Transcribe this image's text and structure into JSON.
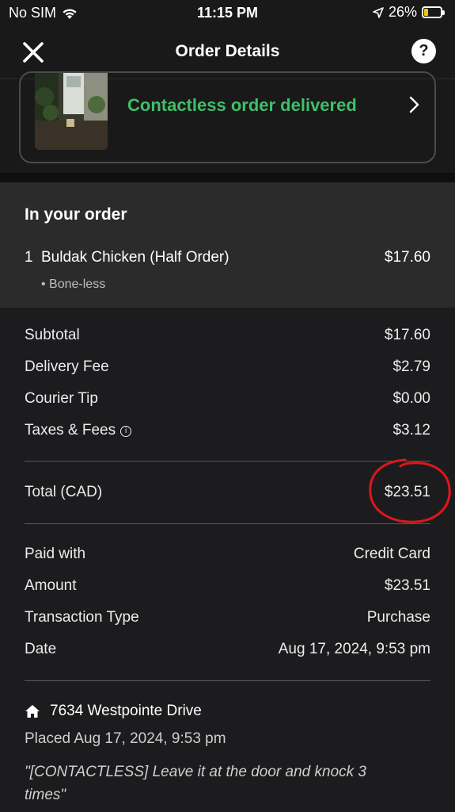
{
  "status_bar": {
    "carrier": "No SIM",
    "time": "11:15 PM",
    "battery_percent": "26%",
    "battery_level": 0.26
  },
  "header": {
    "title": "Order Details",
    "help_label": "?"
  },
  "delivery": {
    "status_text": "Contactless order delivered"
  },
  "order": {
    "heading": "In your order",
    "items": [
      {
        "qty": "1",
        "name": "Buldak Chicken (Half Order)",
        "price": "$17.60",
        "option": "• Bone-less"
      }
    ]
  },
  "summary": {
    "subtotal_label": "Subtotal",
    "subtotal_value": "$17.60",
    "delivery_fee_label": "Delivery Fee",
    "delivery_fee_value": "$2.79",
    "courier_tip_label": "Courier Tip",
    "courier_tip_value": "$0.00",
    "taxes_label": "Taxes & Fees",
    "taxes_value": "$3.12",
    "total_label": "Total (CAD)",
    "total_value": "$23.51"
  },
  "payment": {
    "paid_with_label": "Paid with",
    "paid_with_value": "Credit Card",
    "amount_label": "Amount",
    "amount_value": "$23.51",
    "transaction_type_label": "Transaction Type",
    "transaction_type_value": "Purchase",
    "date_label": "Date",
    "date_value": "Aug 17, 2024, 9:53 pm"
  },
  "footer": {
    "address": "7634 Westpointe Drive",
    "placed": "Placed Aug 17, 2024, 9:53 pm",
    "note": "\"[CONTACTLESS] Leave it at the door and knock 3 times\""
  },
  "colors": {
    "delivered_green": "#3fbf6a",
    "annotation_red": "#e0161b",
    "battery_yellow": "#f2c21a"
  }
}
